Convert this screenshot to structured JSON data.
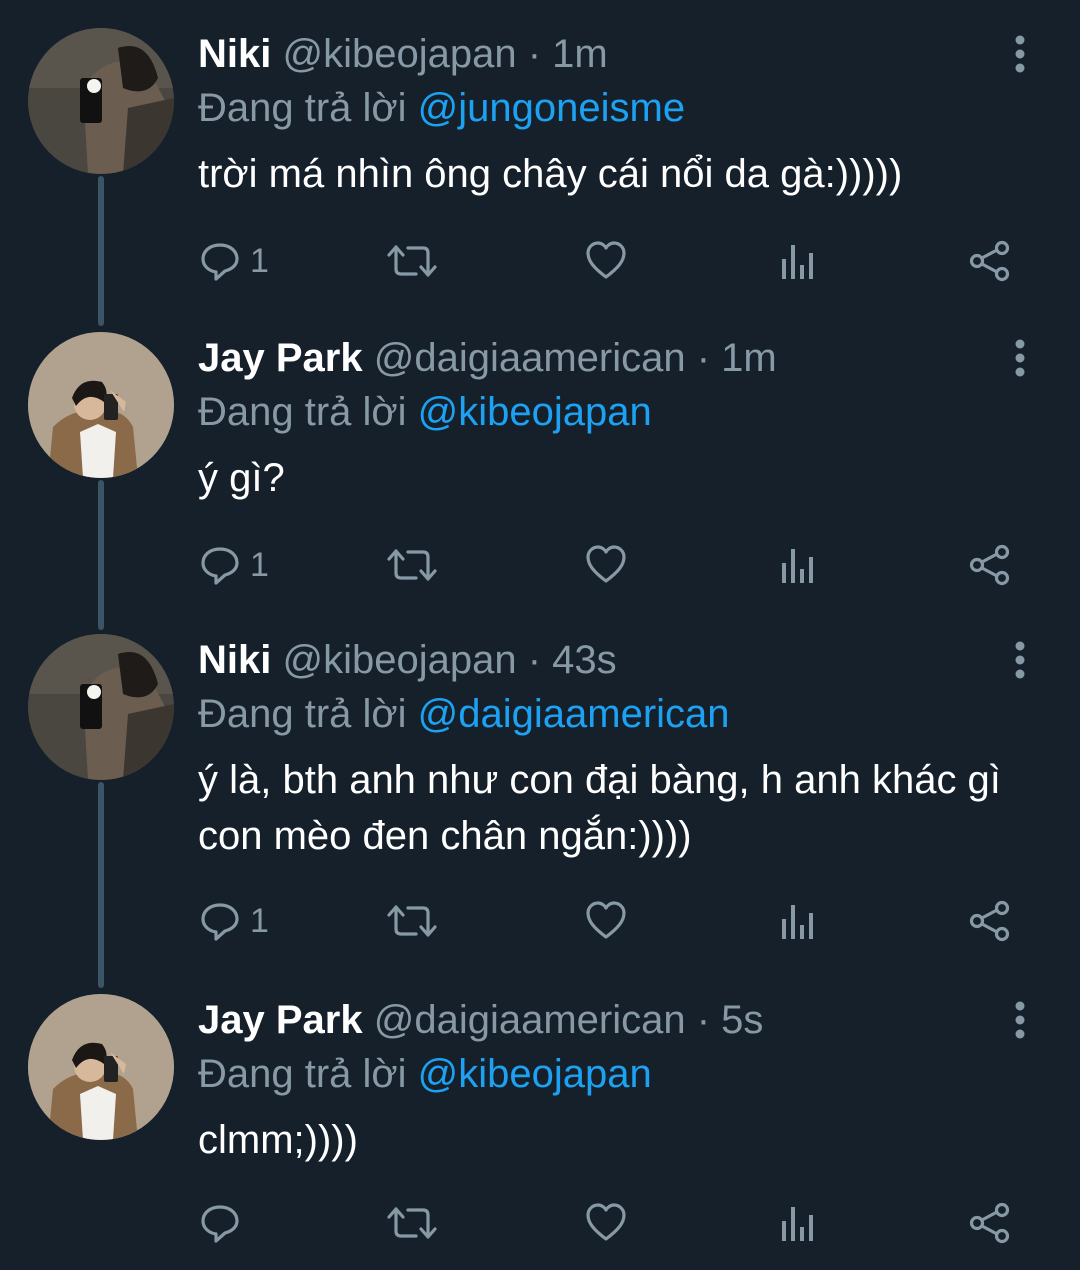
{
  "tweets": [
    {
      "name": "Niki",
      "handle": "@kibeojapan",
      "time": "1m",
      "reply_prefix": "Đang trả lời",
      "reply_to": "@jungoneisme",
      "text": "trời má nhìn ông chây cái nổi da gà:)))))",
      "reply_count": "1"
    },
    {
      "name": "Jay Park",
      "handle": "@daigiaamerican",
      "time": "1m",
      "reply_prefix": "Đang trả lời",
      "reply_to": "@kibeojapan",
      "text": "ý gì?",
      "reply_count": "1"
    },
    {
      "name": "Niki",
      "handle": "@kibeojapan",
      "time": "43s",
      "reply_prefix": "Đang trả lời",
      "reply_to": "@daigiaamerican",
      "text": "ý là, bth anh như con đại bàng, h anh khác gì con mèo đen chân ngắn:))))",
      "reply_count": "1"
    },
    {
      "name": "Jay Park",
      "handle": "@daigiaamerican",
      "time": "5s",
      "reply_prefix": "Đang trả lời",
      "reply_to": "@kibeojapan",
      "text": "clmm;))))",
      "reply_count": ""
    }
  ],
  "separator": " · ",
  "icons": {
    "reply": "reply-icon",
    "retweet": "retweet-icon",
    "like": "heart-icon",
    "analytics": "analytics-icon",
    "share": "share-icon",
    "more": "more-vertical-icon"
  },
  "colors": {
    "background": "#15202b",
    "text": "#ffffff",
    "secondary": "#8899a6",
    "link": "#1da1f2",
    "thread_line": "#3d5466"
  }
}
